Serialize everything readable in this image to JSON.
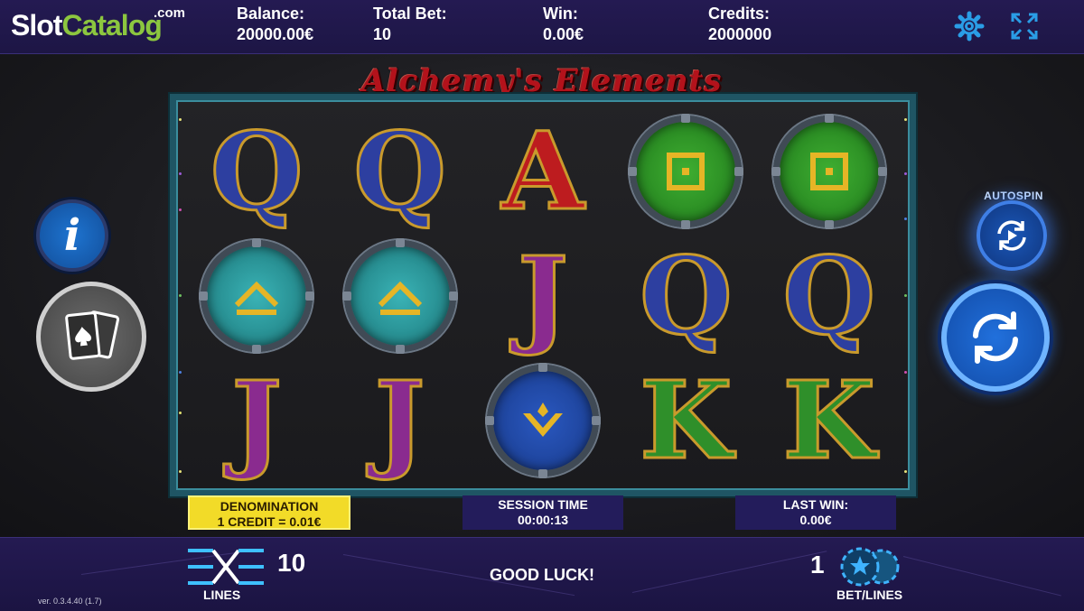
{
  "header": {
    "logo_main": "SlotCatalog",
    "logo_part1": "Slot",
    "logo_part2": "Catalog",
    "logo_suffix": ".com",
    "balance_label": "Balance:",
    "balance_value": "20000.00€",
    "total_bet_label": "Total Bet:",
    "total_bet_value": "10",
    "win_label": "Win:",
    "win_value": "0.00€",
    "credits_label": "Credits:",
    "credits_value": "2000000",
    "settings_icon": "gear-icon",
    "fullscreen_icon": "fullscreen-icon"
  },
  "game": {
    "title": "Alchemy's Elements",
    "reels": [
      [
        "Q",
        "Q",
        "A",
        "earth",
        "earth"
      ],
      [
        "air",
        "air",
        "J",
        "Q",
        "Q"
      ],
      [
        "J",
        "J",
        "water",
        "K",
        "K"
      ]
    ],
    "symbol_colors": {
      "Q": "#2d3fa0",
      "A": "#bd1c1f",
      "J": "#8a2b8f",
      "K": "#2f8f2a",
      "earth": "#2f9a2a",
      "air": "#2a9ea2",
      "water": "#2550b0",
      "gold": "#e6b526"
    }
  },
  "controls": {
    "info_label": "i",
    "info_icon": "info-icon",
    "gamble_icon": "playing-cards-icon",
    "autospin_label": "AUTOSPIN",
    "autospin_icon": "autospin-icon",
    "spin_icon": "spin-icon"
  },
  "info": {
    "denomination_label": "DENOMINATION",
    "denomination_value": "1 CREDIT = 0.01€",
    "session_label": "SESSION TIME",
    "session_value": "00:00:13",
    "last_win_label": "LAST WIN:",
    "last_win_value": "0.00€"
  },
  "footer": {
    "lines_value": "10",
    "lines_label": "LINES",
    "lines_icon": "lines-icon",
    "message": "GOOD LUCK!",
    "bet_value": "1",
    "bet_label": "BET/LINES",
    "chips_icon": "chips-icon",
    "version": "ver. 0.3.4.40 (1.7)"
  }
}
